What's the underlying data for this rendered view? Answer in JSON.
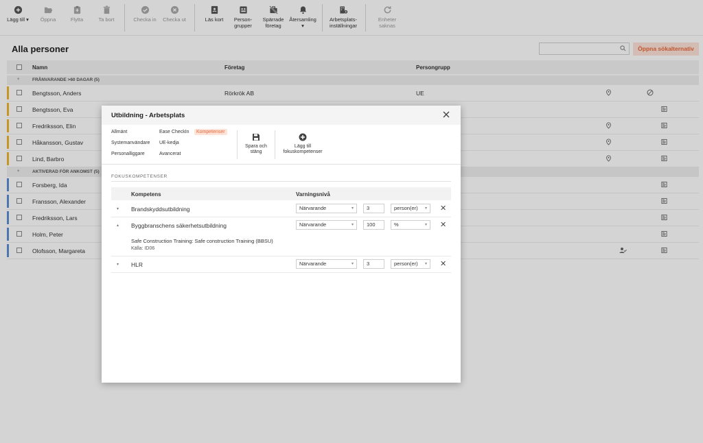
{
  "toolbar": {
    "add_label": "Lägg till",
    "open_label": "Öppna",
    "move_label": "Flytta",
    "delete_label": "Ta bort",
    "checkin_label": "Checka in",
    "checkout_label": "Checka ut",
    "readcard_label": "Läs kort",
    "persongroups_line1": "Person-",
    "persongroups_line2": "grupper",
    "blocked_line1": "Spärrade",
    "blocked_line2": "företag",
    "reassembly_label": "Återsamling",
    "workplace_line1": "Arbetsplats-",
    "workplace_line2": "inställningar",
    "units_line1": "Enheter",
    "units_line2": "saknas"
  },
  "page": {
    "title": "Alla personer",
    "search_placeholder": "",
    "advanced_search_label": "Öppna sökalternativ"
  },
  "table": {
    "columns": [
      "Namn",
      "Företag",
      "Persongrupp"
    ],
    "groups": [
      {
        "label": "FRÅNVARANDE >60 DAGAR (5)",
        "rows": [
          {
            "name": "Bengtsson, Anders",
            "company": "Rörkrök AB",
            "group": "UE"
          },
          {
            "name": "Bengtsson, Eva",
            "company": "",
            "group": ""
          },
          {
            "name": "Fredriksson, Elin",
            "company": "",
            "group": ""
          },
          {
            "name": "Håkansson, Gustav",
            "company": "",
            "group": ""
          },
          {
            "name": "Lind, Barbro",
            "company": "",
            "group": ""
          }
        ]
      },
      {
        "label": "AKTIVERAD FÖR ANKOMST (5)",
        "rows": [
          {
            "name": "Forsberg, Ida",
            "company": "",
            "group": ""
          },
          {
            "name": "Fransson, Alexander",
            "company": "",
            "group": ""
          },
          {
            "name": "Fredriksson, Lars",
            "company": "",
            "group": ""
          },
          {
            "name": "Holm, Peter",
            "company": "",
            "group": ""
          },
          {
            "name": "Olofsson, Margareta",
            "company": "",
            "group": ""
          }
        ]
      }
    ]
  },
  "modal": {
    "title": "Utbildning - Arbetsplats",
    "nav": {
      "general": "Allmänt",
      "ease_checkin": "Ease CheckIn",
      "competences": "Kompetenser",
      "system_users": "Systemanvändare",
      "ue_chain": "UE-kedja",
      "personnel_ledger": "Personalliggare",
      "advanced": "Avancerat"
    },
    "save_line1": "Spara och",
    "save_line2": "stäng",
    "add_focus_line1": "Lägg till",
    "add_focus_line2": "fokuskompetenser",
    "section_title": "FOKUSKOMPETENSER",
    "columns": {
      "competence": "Kompetens",
      "warning_level": "Varningsnivå"
    },
    "competences": [
      {
        "name": "Brandskyddsutbildning",
        "status": "Närvarande",
        "value": "3",
        "unit": "person(er)"
      },
      {
        "name": "Byggbranschens säkerhetsutbildning",
        "status": "Närvarande",
        "value": "100",
        "unit": "%",
        "detail": "Safe Construction Training: Safe construction Training (BBSU)",
        "source": "Källa: ID06"
      },
      {
        "name": "HLR",
        "status": "Närvarande",
        "value": "3",
        "unit": "person(er)"
      }
    ]
  },
  "colors": {
    "accent": "#e8683a",
    "accent_bg": "#fde3d8",
    "group_absent": "#f0b429",
    "group_arrival": "#5b8fd6"
  }
}
